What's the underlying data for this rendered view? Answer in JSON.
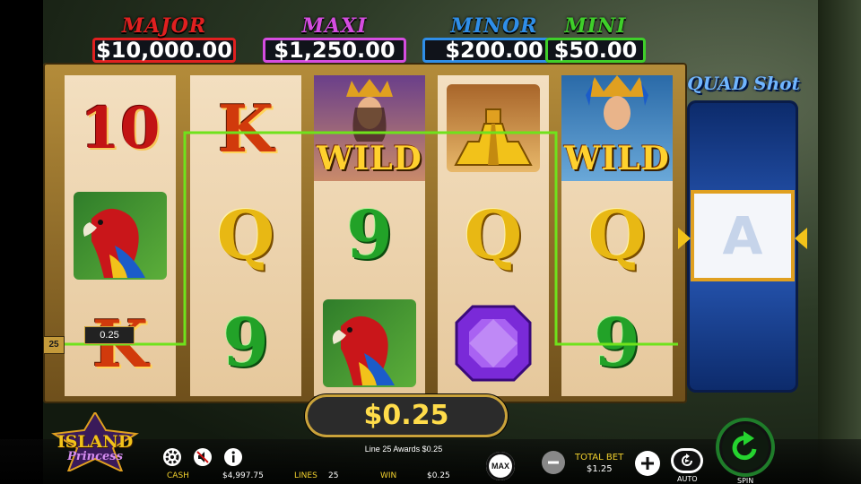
{
  "jackpots": [
    {
      "name": "MAJOR",
      "value": "$10,000.00",
      "color": "#e02020"
    },
    {
      "name": "MAXI",
      "value": "$1,250.00",
      "color": "#d54de0"
    },
    {
      "name": "MINOR",
      "value": "$200.00",
      "color": "#2f8ee8"
    },
    {
      "name": "MINI",
      "value": "$50.00",
      "color": "#3fcf2a"
    }
  ],
  "reels": [
    [
      "10",
      "parrot",
      "K"
    ],
    [
      "K",
      "Q",
      "9"
    ],
    [
      "WILD",
      "9",
      "parrot"
    ],
    [
      "pyramid",
      "Q",
      "purple-gem"
    ],
    [
      "WILD",
      "Q",
      "9"
    ]
  ],
  "quad_shot": {
    "title": "QUAD Shot",
    "center_symbol": "A"
  },
  "payline": {
    "number": "25",
    "bet_label": "0.25",
    "color": "#6fe21c"
  },
  "win_display": "$0.25",
  "status_message": "Line 25 Awards $0.25",
  "logo": {
    "line1": "ISLAND",
    "line2": "Princess"
  },
  "stats": {
    "cash_label": "CASH",
    "cash_value": "$4,997.75",
    "lines_label": "LINES",
    "lines_value": "25",
    "win_label": "WIN",
    "win_value": "$0.25"
  },
  "bet": {
    "label": "TOTAL BET",
    "value": "$1.25"
  },
  "buttons": {
    "max": "MAX",
    "auto": "AUTO",
    "spin": "SPIN"
  },
  "icons": [
    "settings-gear-icon",
    "sound-muted-icon",
    "info-icon",
    "minus-icon",
    "plus-icon",
    "autoplay-icon",
    "spin-arrow-icon"
  ]
}
